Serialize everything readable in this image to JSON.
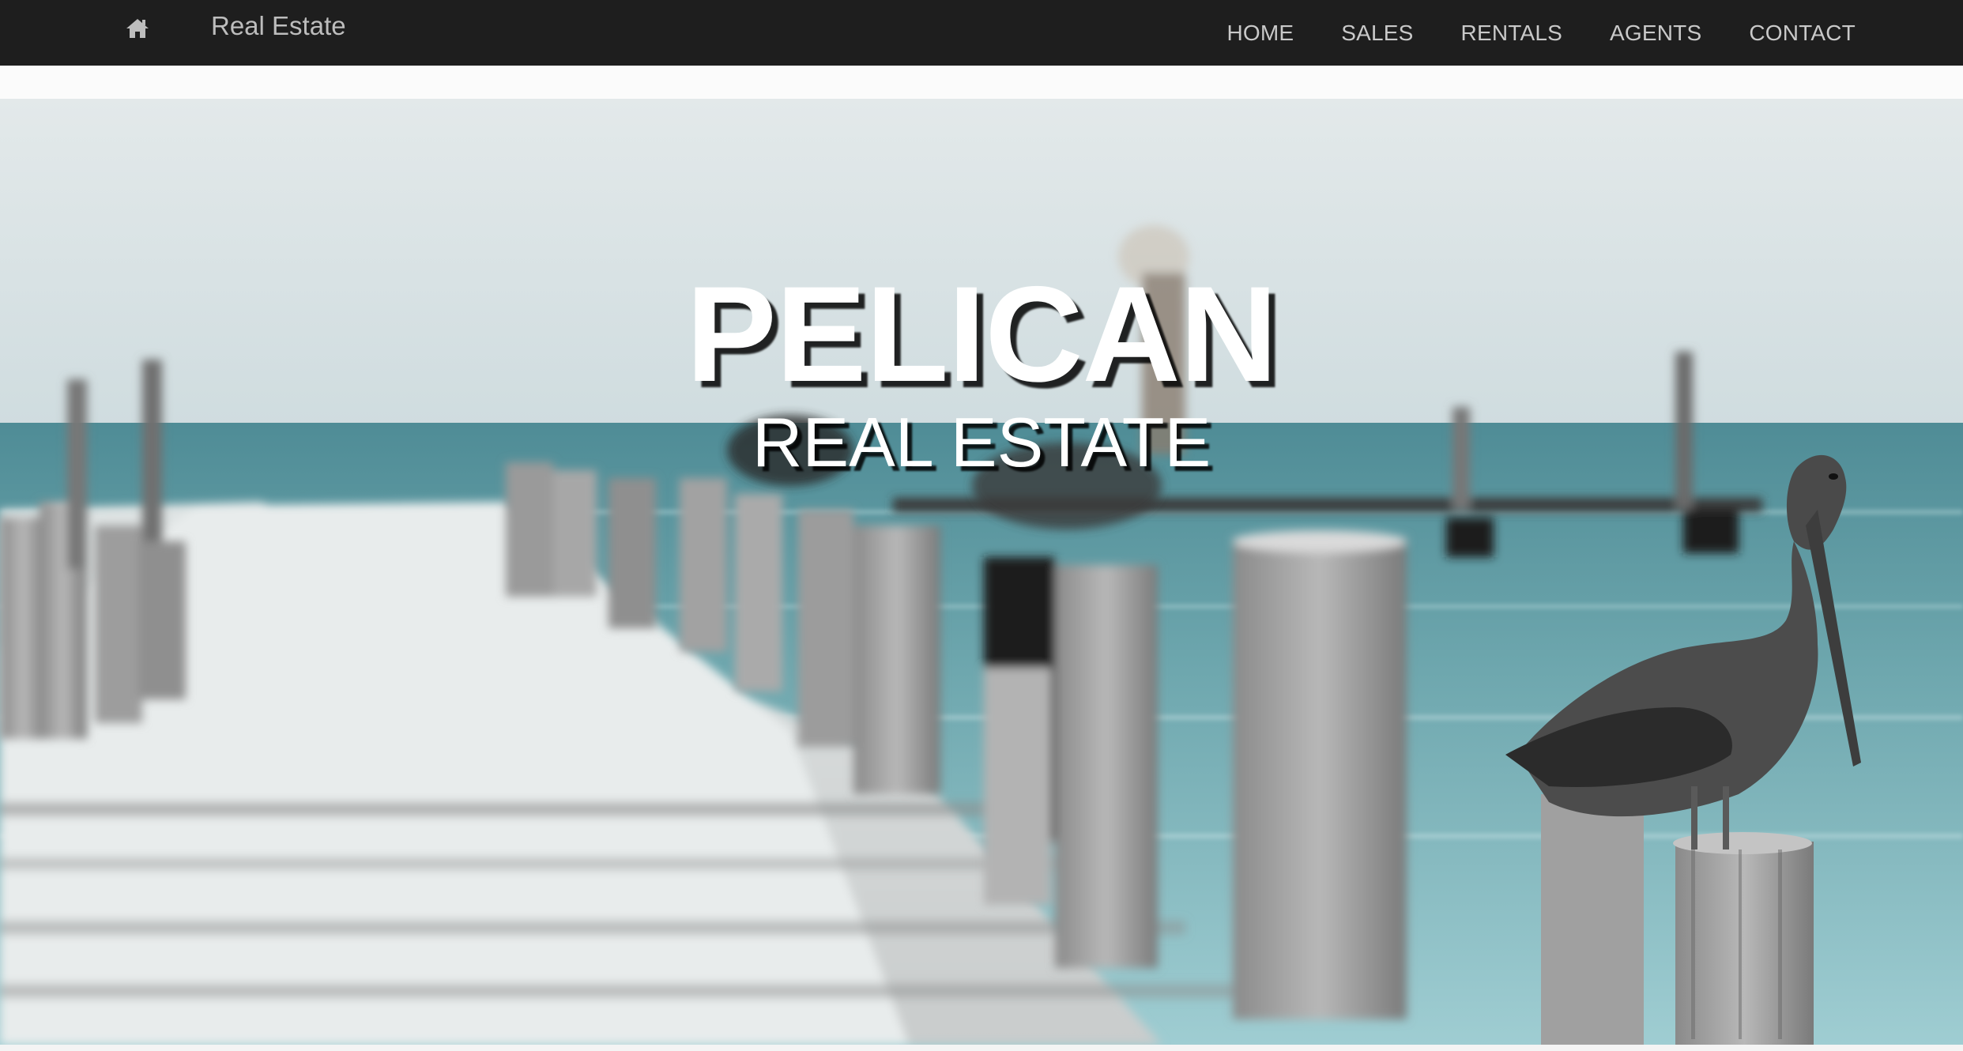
{
  "navbar": {
    "home_icon": "home-icon",
    "brand": "Real Estate",
    "links": [
      {
        "label": "HOME"
      },
      {
        "label": "SALES"
      },
      {
        "label": "RENTALS"
      },
      {
        "label": "AGENTS"
      },
      {
        "label": "CONTACT"
      }
    ]
  },
  "hero": {
    "title": "PELICAN",
    "subtitle": "REAL ESTATE",
    "image": "pelican-pier-photo"
  },
  "colors": {
    "navbar_bg": "#1e1e1e",
    "nav_text": "#c9c9c9",
    "hero_text": "#ffffff",
    "sea": "#5f9aa3",
    "sky": "#dfe6e8"
  }
}
